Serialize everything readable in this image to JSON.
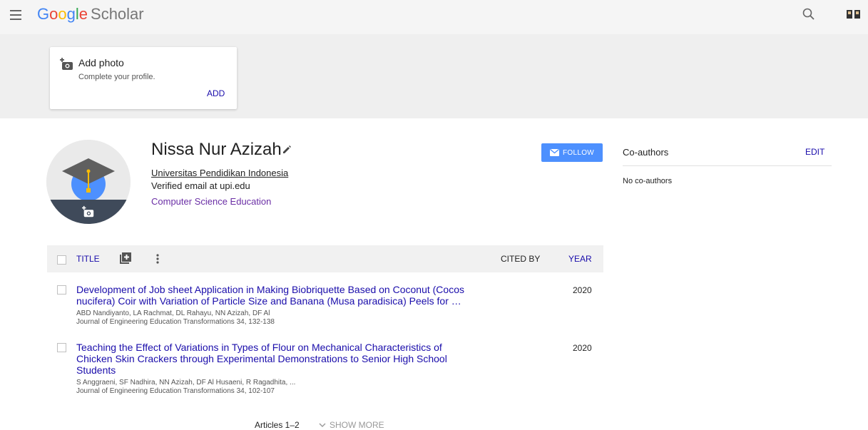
{
  "header": {
    "logo_word": "Google",
    "logo_suffix": "Scholar"
  },
  "icons": {
    "menu": "menu-icon",
    "search": "search-icon",
    "account": "account-icon",
    "add_photo": "add-photo-icon",
    "edit": "pencil-icon",
    "mail": "mail-icon",
    "add_article": "add-box-icon",
    "more": "more-vert-icon",
    "chevron": "chevron-down-icon"
  },
  "photo_card": {
    "title": "Add photo",
    "subtitle": "Complete your profile.",
    "action": "ADD"
  },
  "profile": {
    "name": "Nissa Nur Azizah",
    "affiliation": "Universitas Pendidikan Indonesia",
    "email": "Verified email at upi.edu",
    "interest": "Computer Science Education",
    "follow_label": "FOLLOW"
  },
  "coauthors": {
    "title": "Co-authors",
    "edit_label": "EDIT",
    "empty_text": "No co-authors"
  },
  "table": {
    "col_title": "TITLE",
    "col_cited": "CITED BY",
    "col_year": "YEAR"
  },
  "articles": [
    {
      "title_line1": "Development of Job sheet Application in Making Biobriquette Based on Coconut (Cocos",
      "title_line2": "nucifera) Coir with Variation of Particle Size and Banana (Musa paradisica) Peels for …",
      "authors": "ABD Nandiyanto, LA Rachmat, DL Rahayu, NN Azizah, DF Al",
      "journal": "Journal of Engineering Education Transformations 34, 132-138",
      "year": "2020"
    },
    {
      "title_line1": "Teaching the Effect of Variations in Types of Flour on Mechanical Characteristics of",
      "title_line2": "Chicken Skin Crackers through Experimental Demonstrations to Senior High School",
      "title_line3": "Students",
      "authors": "S Anggraeni, SF Nadhira, NN Azizah, DF Al Husaeni, R Ragadhita, ...",
      "journal": "Journal of Engineering Education Transformations 34, 102-107",
      "year": "2020"
    }
  ],
  "footer": {
    "articles_count": "Articles 1–2",
    "show_more": "SHOW MORE"
  },
  "colors": {
    "link": "#1a0dab",
    "follow_button": "#4d90fe",
    "interest": "#6a2ea5"
  }
}
